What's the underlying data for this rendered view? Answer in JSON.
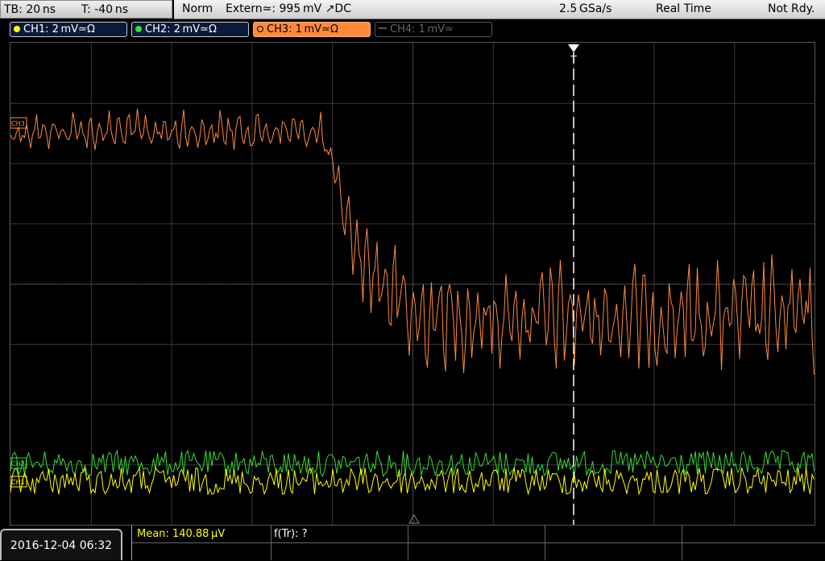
{
  "topbar": {
    "timebase": "TB: 20 ns",
    "trigger_time": "T: -40 ns"
  },
  "status": {
    "mode": "Norm",
    "trigger": "Extern≃: 995 mV ↗DC",
    "sample_rate": "2.5 GSa/s",
    "acq_mode": "Real Time",
    "state": "Not Rdy."
  },
  "channels": [
    {
      "label": "CH1: 2 mV≃Ω",
      "color": "#ffff00"
    },
    {
      "label": "CH2: 2 mV≃Ω",
      "color": "#33dd33"
    },
    {
      "label": "CH3: 1 mV≃Ω",
      "color": "#ff8a3c"
    },
    {
      "label": "CH4: 1 mV≃",
      "color": "#777777"
    }
  ],
  "markers": {
    "ch3": "CH3",
    "ch2": "CH2",
    "ch1": "CH1",
    "trigger": "T"
  },
  "measurements": {
    "mean": "Mean: 140.88 µV",
    "ftr": "f(Tr): ?"
  },
  "datetime": "2016-12-04 06:32",
  "colors": {
    "ch1": "#ffff00",
    "ch2": "#33dd33",
    "ch3": "#ff8a3c",
    "ch4": "#777777"
  }
}
